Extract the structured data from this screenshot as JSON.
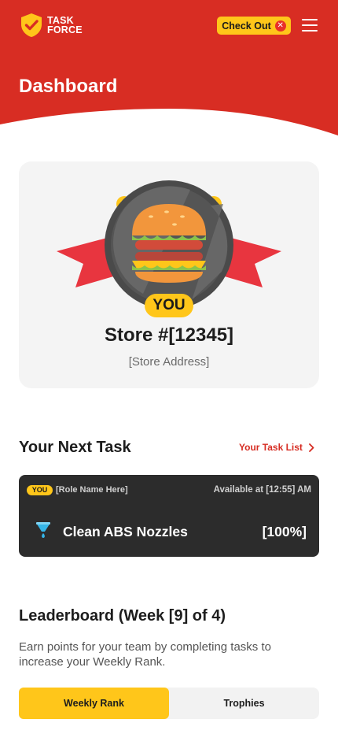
{
  "header": {
    "logo_line1": "TASK",
    "logo_line2": "FORCE",
    "checkout_label": "Check Out",
    "page_title": "Dashboard",
    "brand_red": "#d82d23",
    "accent_yellow": "#ffc61a"
  },
  "store": {
    "you_badge": "YOU",
    "name": "Store #[12345]",
    "address": "[Store Address]"
  },
  "next_task": {
    "section_title": "Your Next Task",
    "task_list_link": "Your Task List",
    "you_tag": "YOU",
    "role": "[Role Name Here]",
    "available": "Available at [12:55] AM",
    "name": "Clean ABS Nozzles",
    "progress_label": "[100%]",
    "progress": 1.0
  },
  "leaderboard": {
    "title": "Leaderboard (Week [9] of 4)",
    "description": "Earn points for your team by completing tasks to increase your Weekly Rank.",
    "tabs": [
      "Weekly Rank",
      "Trophies"
    ],
    "active_tab": "Weekly Rank"
  }
}
